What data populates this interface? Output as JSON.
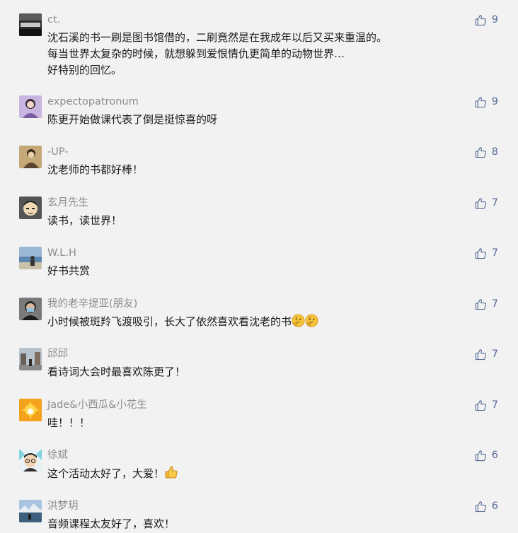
{
  "colors": {
    "background": "#f2f2f2",
    "nickname": "#8c8c8c",
    "text": "#191919",
    "like": "#576b95"
  },
  "comments": [
    {
      "nickname": "ct.",
      "lines": [
        "沈石溪的书一刷是图书馆借的，二刷竟然是在我成年以后又买来重温的。",
        "每当世界太复杂的时候，就想躲到爱恨情仇更简单的动物世界…",
        "好特别的回忆。"
      ],
      "likes": "9",
      "avatar_icon": "dark-photo-avatar"
    },
    {
      "nickname": "expectopatronum",
      "lines": [
        "陈更开始做课代表了倒是挺惊喜的呀"
      ],
      "likes": "9",
      "avatar_icon": "purple-portrait-avatar"
    },
    {
      "nickname": "-UP-",
      "lines": [
        "沈老师的书都好棒！"
      ],
      "likes": "8",
      "avatar_icon": "painting-avatar"
    },
    {
      "nickname": "玄月先生",
      "lines": [
        "读书，读世界！"
      ],
      "likes": "7",
      "avatar_icon": "cartoon-face-avatar"
    },
    {
      "nickname": "W.L.H",
      "lines": [
        "好书共赏"
      ],
      "likes": "7",
      "avatar_icon": "seaside-avatar"
    },
    {
      "nickname": "我的老辛提亚(朋友)",
      "lines": [
        "小时候被斑羚飞渡吸引，长大了依然喜欢看沈老的书"
      ],
      "likes": "7",
      "avatar_icon": "masked-person-avatar",
      "emoji": [
        "thinking-emoji",
        "thinking-emoji"
      ]
    },
    {
      "nickname": "邱邱",
      "lines": [
        "看诗词大会时最喜欢陈更了！"
      ],
      "likes": "7",
      "avatar_icon": "city-street-avatar"
    },
    {
      "nickname": "Jade&小西瓜&小花生",
      "lines": [
        "哇！！！"
      ],
      "likes": "7",
      "avatar_icon": "sun-avatar"
    },
    {
      "nickname": "徐斌",
      "lines": [
        "这个活动太好了，大爱！"
      ],
      "likes": "6",
      "avatar_icon": "glasses-cartoon-avatar",
      "emoji": [
        "thumbs-up-emoji"
      ]
    },
    {
      "nickname": "洪梦玥",
      "lines": [
        "音频课程太友好了，喜欢！"
      ],
      "likes": "6",
      "avatar_icon": "mountain-lake-avatar"
    }
  ]
}
